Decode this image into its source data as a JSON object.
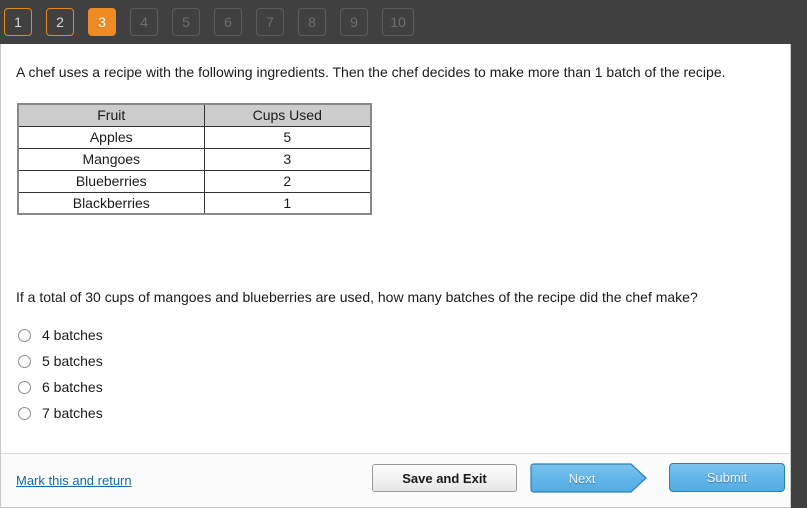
{
  "nav": {
    "items": [
      {
        "label": "1",
        "state": "visited"
      },
      {
        "label": "2",
        "state": "visited"
      },
      {
        "label": "3",
        "state": "current"
      },
      {
        "label": "4",
        "state": "disabled"
      },
      {
        "label": "5",
        "state": "disabled"
      },
      {
        "label": "6",
        "state": "disabled"
      },
      {
        "label": "7",
        "state": "disabled"
      },
      {
        "label": "8",
        "state": "disabled"
      },
      {
        "label": "9",
        "state": "disabled"
      },
      {
        "label": "10",
        "state": "disabled"
      }
    ],
    "colors": {
      "bar_background": "#404040",
      "current_fill": "#ef8b23",
      "visited_border": "#e8891f",
      "disabled_border": "#5d5d5d",
      "disabled_text": "#6e6e6e"
    }
  },
  "question": {
    "prompt": "A chef uses a recipe with the following ingredients. Then the chef decides to make more than 1 batch of the recipe.",
    "question_text": "If a total of 30 cups of mangoes and blueberries are used, how many batches of the recipe did the chef make?",
    "table": {
      "headers": [
        "Fruit",
        "Cups Used"
      ],
      "rows": [
        [
          "Apples",
          "5"
        ],
        [
          "Mangoes",
          "3"
        ],
        [
          "Blueberries",
          "2"
        ],
        [
          "Blackberries",
          "1"
        ]
      ],
      "header_background": "#cccccc"
    },
    "choices": [
      {
        "label": "4 batches",
        "selected": false
      },
      {
        "label": "5 batches",
        "selected": false
      },
      {
        "label": "6 batches",
        "selected": false
      },
      {
        "label": "7 batches",
        "selected": false
      }
    ]
  },
  "footer": {
    "mark_link": "Mark this and return",
    "save_and_exit": "Save and Exit",
    "next": "Next",
    "submit": "Submit",
    "link_color": "#17699e",
    "primary_button_color": "#62b5e8"
  }
}
